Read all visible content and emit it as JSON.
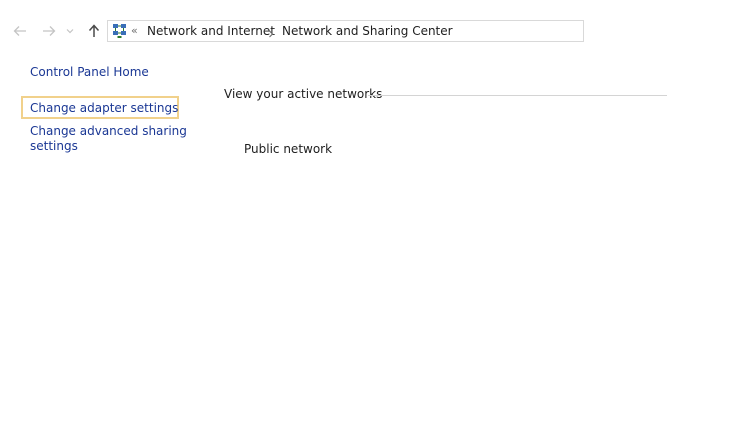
{
  "navigation": {
    "back_icon": "arrow-left-icon",
    "forward_icon": "arrow-right-icon",
    "recent_icon": "chevron-down-icon",
    "up_icon": "arrow-up-icon"
  },
  "address_bar": {
    "icon": "network-control-panel-icon",
    "overflow": "«",
    "breadcrumbs": [
      {
        "label": "Network and Internet"
      },
      {
        "label": "Network and Sharing Center"
      }
    ]
  },
  "sidebar": {
    "items": [
      {
        "label": "Control Panel Home"
      },
      {
        "label": "Change adapter settings",
        "focused": true
      },
      {
        "label_line1": "Change advanced sharing",
        "label_line2": "settings"
      }
    ]
  },
  "main": {
    "section_heading": "View your active networks",
    "networks": [
      {
        "type": "Public network"
      }
    ]
  },
  "colors": {
    "link": "#1a3794",
    "focus_outline": "#f1d18b",
    "text": "#1e1e1e",
    "border": "#d9d9d9"
  }
}
